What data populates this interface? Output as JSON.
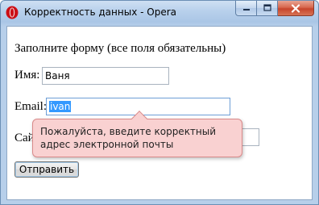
{
  "window": {
    "title": "Корректность данных - Opera",
    "icon": "opera-logo-icon",
    "controls": [
      "minimize-icon",
      "maximize-icon",
      "close-icon"
    ]
  },
  "form": {
    "heading": "Заполните форму (все поля обязательны)",
    "name_label": "Имя:",
    "name_value": "Ваня",
    "email_label": "Email:",
    "email_value": "ivan",
    "site_label": "Сай",
    "site_value": "",
    "submit_label": "Отправить"
  },
  "tooltip": {
    "message": "Пожалуйста, введите корректный адрес электронной почты"
  },
  "colors": {
    "selection": "#3399ff",
    "tooltip_bg": "#f9d1d1",
    "close_button": "#c7452c"
  }
}
